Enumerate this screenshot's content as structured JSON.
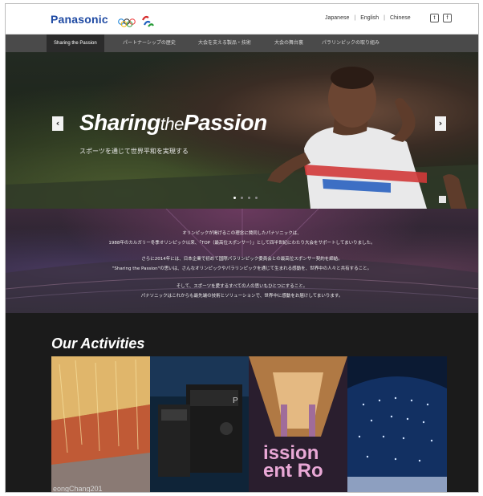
{
  "header": {
    "brand": "Panasonic",
    "languages": [
      "Japanese",
      "English",
      "Chinese"
    ],
    "social": [
      "twitter-icon",
      "facebook-icon"
    ]
  },
  "nav": {
    "items": [
      "Sharing the Passion",
      "パートナーシップの歴史",
      "大会を支える製品・技術",
      "大会の舞台裏",
      "パラリンピックの取り組み"
    ]
  },
  "hero": {
    "title_part1": "Sharing",
    "title_part2": "the",
    "title_part3": "Passion",
    "subtitle": "スポーツを通じて世界平和を実現する",
    "prev_icon": "‹",
    "next_icon": "›"
  },
  "statement": {
    "lines": [
      "オリンピックが掲げるこの理念に賛同したパナソニックは、",
      "1988年のカルガリー冬季オリンピック以来、「TOP（最高位スポンサー）」として四半世紀にわたり大会をサポートしてまいりました。",
      "さらに2014年には、日本企業で初めて国際パラリンピック委員会との最高位スポンサー契約を締結。",
      "\"Sharing the Passion\"の思いは、さんなオリンピックやパラリンピックを通じて生まれる感動を、世界中の人々と共有すること。",
      "そして、スポーツを愛するすべての人の思いもひとつにすること。",
      "パナソニックはこれからも最先端の技術とソリューションで、世界中に感動をお届けしてまいります。"
    ]
  },
  "activities": {
    "title": "Our Activities",
    "tile1_caption": "eongChang201",
    "tile3_text_line1": "ission",
    "tile3_text_line2": "ent Ro"
  }
}
